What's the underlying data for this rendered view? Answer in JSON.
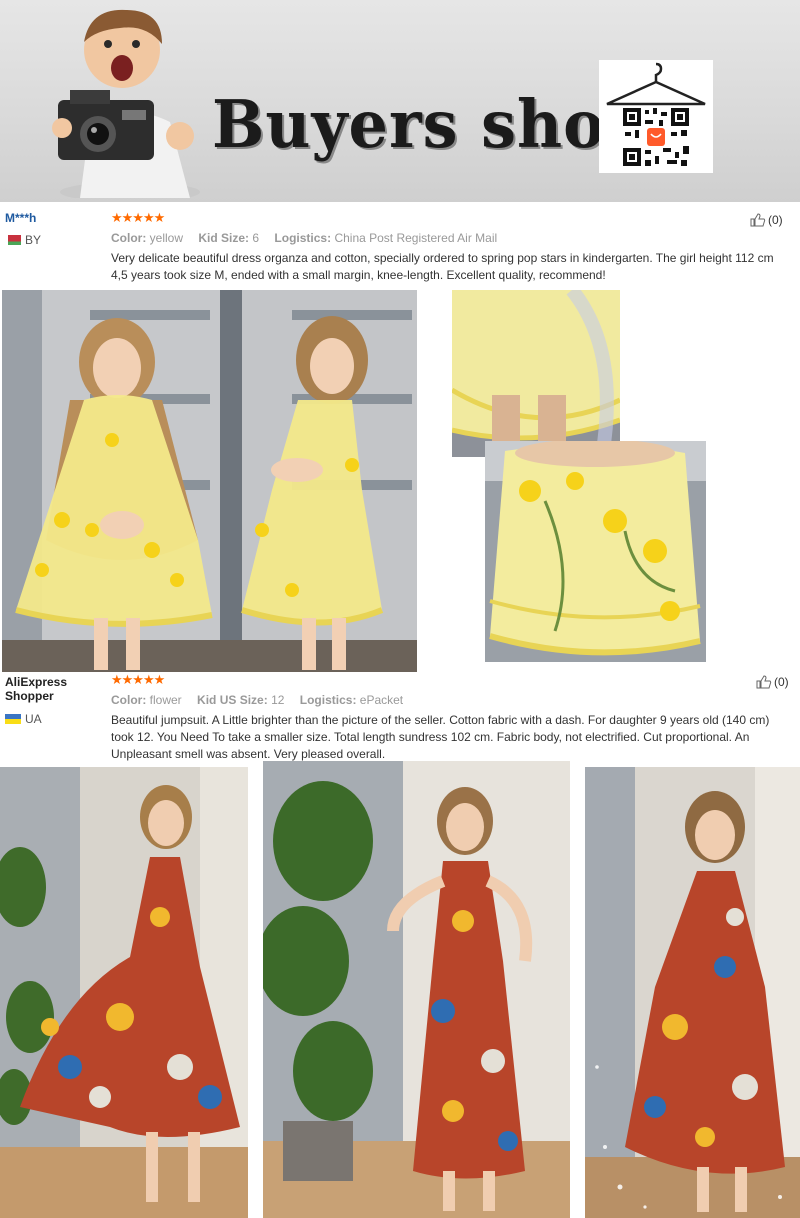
{
  "banner": {
    "title": "Buyers show",
    "icons": [
      "boy-with-camera",
      "qr-code-hanger"
    ]
  },
  "reviews": [
    {
      "name": "M***h",
      "country": "BY",
      "stars": "★★★★★",
      "attributes": [
        {
          "label": "Color:",
          "value": "yellow"
        },
        {
          "label": "Kid Size:",
          "value": "6"
        },
        {
          "label": "Logistics:",
          "value": "China Post Registered Air Mail"
        }
      ],
      "text": "Very delicate beautiful dress organza and cotton, specially ordered to spring pop stars in kindergarten. The girl height 112 cm 4,5 years took size M, ended with a small margin, knee-length. Excellent quality, recommend!",
      "helpful": "(0)"
    },
    {
      "name": "AliExpress Shopper",
      "country": "UA",
      "stars": "★★★★★",
      "attributes": [
        {
          "label": "Color:",
          "value": "flower"
        },
        {
          "label": "Kid US Size:",
          "value": "12"
        },
        {
          "label": "Logistics:",
          "value": "ePacket"
        }
      ],
      "text": "Beautiful jumpsuit. A Little brighter than the picture of the seller. Cotton fabric with a dash. For daughter 9 years old (140 cm) took 12. You Need To take a smaller size. Total length sundress 102 cm. Fabric body, not electrified. Cut proportional. An Unpleasant smell was absent. Very pleased overall.",
      "helpful": "(0)"
    }
  ],
  "colors": {
    "name_link": "#1f5aa0",
    "star": "#ff6a00",
    "dress_yellow": "#f3e98a",
    "banner_bg": "#d9d9d9"
  }
}
